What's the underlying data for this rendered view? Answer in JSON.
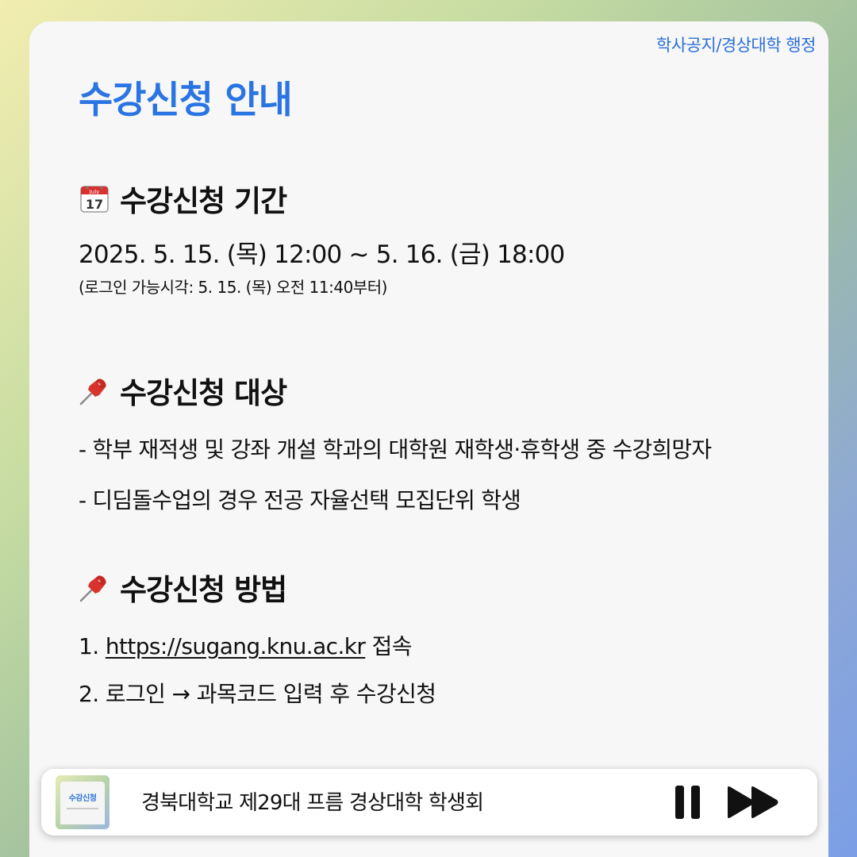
{
  "header": {
    "breadcrumb": "학사공지/경상대학 행정",
    "title": "수강신청 안내"
  },
  "sections": [
    {
      "icon": "calendar-icon",
      "heading": "수강신청 기간",
      "main": "2025. 5. 15. (목) 12:00 ~ 5. 16. (금) 18:00",
      "sub": "(로그인 가능시각: 5. 15. (목) 오전 11:40부터)",
      "icon_month": "July",
      "icon_day": "17"
    },
    {
      "icon": "pushpin-icon",
      "heading": "수강신청 대상",
      "items": [
        "- 학부 재적생 및 강좌 개설 학과의 대학원 재학생·휴학생 중 수강희망자",
        "- 디딤돌수업의 경우 전공 자율선택 모집단위 학생"
      ]
    },
    {
      "icon": "pushpin-icon",
      "heading": "수강신청 방법",
      "steps": [
        {
          "prefix": "1. ",
          "link": "https://sugang.knu.ac.kr",
          "suffix": " 접속"
        },
        {
          "prefix": "2. 로그인 → 과목코드 입력 후 수강신청"
        }
      ]
    }
  ],
  "player": {
    "thumb_title": "수강신청",
    "track_title": "경북대학교 제29대 프름 경상대학 학생회",
    "pause_icon": "pause-icon",
    "next_icon": "fast-forward-icon"
  },
  "colors": {
    "accent": "#2a74e3",
    "breadcrumb": "#2a6fd8",
    "card": "#f7f7f7",
    "calendar_red": "#d8322f",
    "pin_red": "#d9342b"
  }
}
